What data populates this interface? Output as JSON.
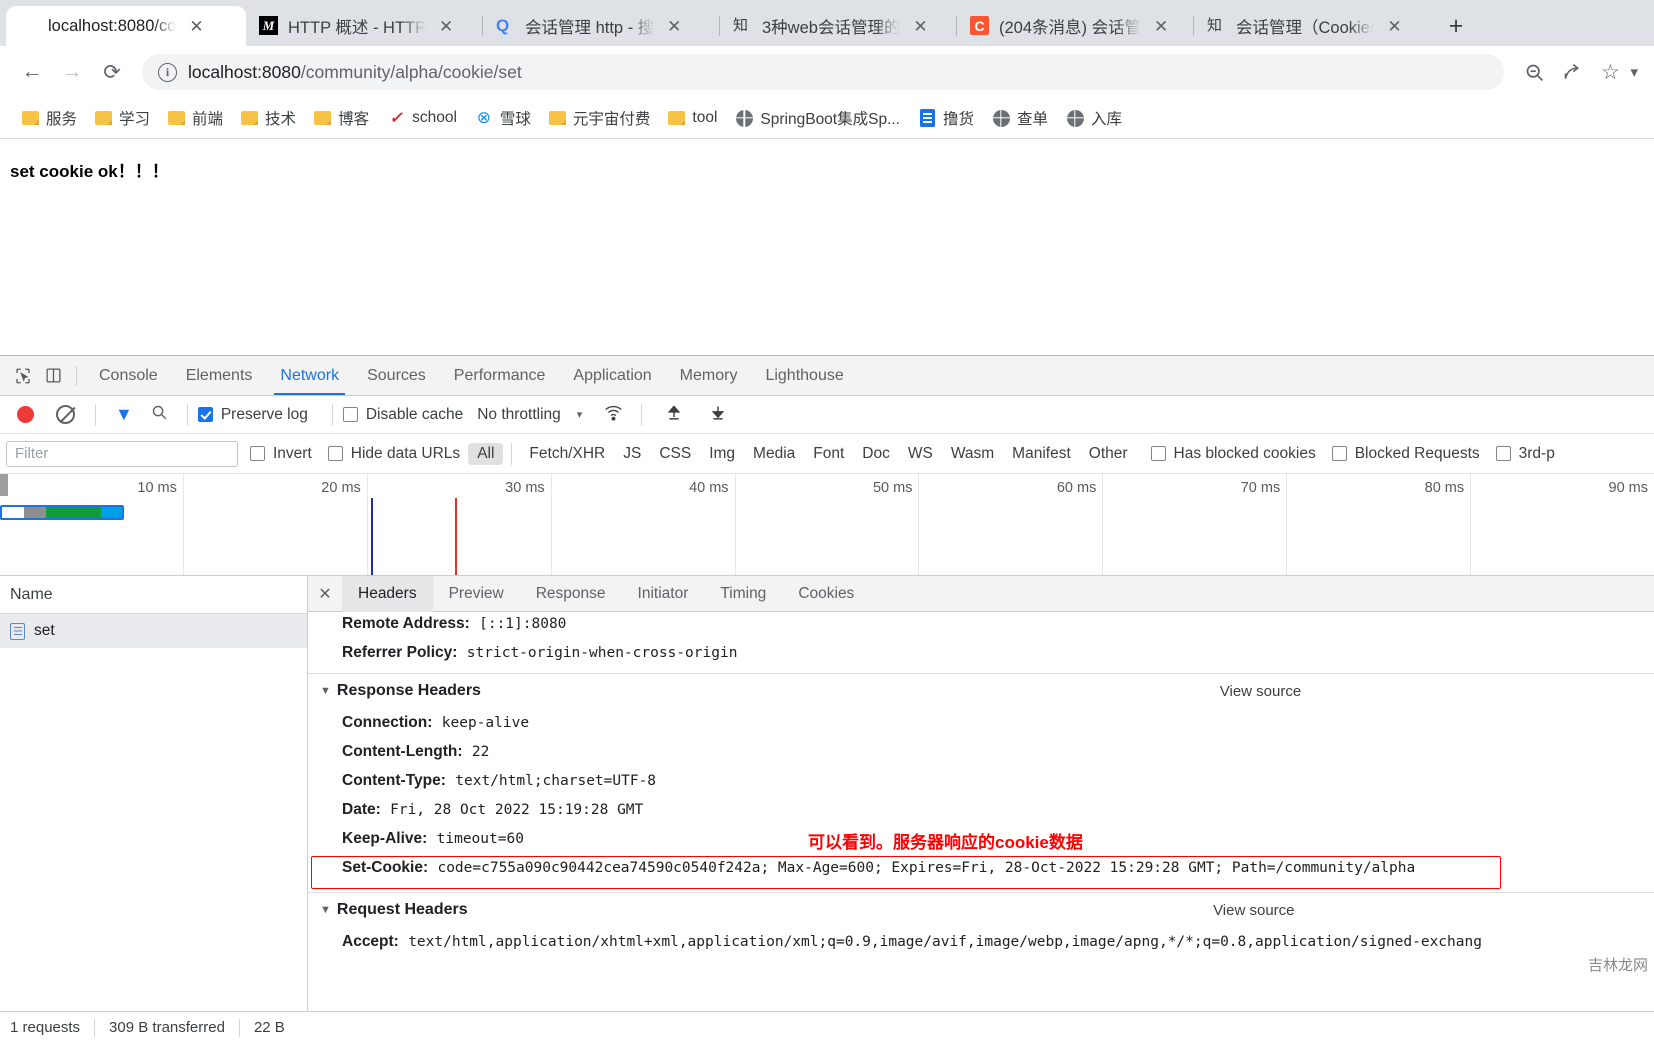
{
  "browser": {
    "tabs": [
      {
        "title": "localhost:8080/co",
        "favicon": "globe-icon",
        "active": true
      },
      {
        "title": "HTTP 概述 - HTTP",
        "favicon": "mdn-icon",
        "active": false
      },
      {
        "title": "会话管理 http - 搜",
        "favicon": "search-icon",
        "active": false
      },
      {
        "title": "3种web会话管理的",
        "favicon": "zhihu-icon",
        "active": false
      },
      {
        "title": "(204条消息) 会话管",
        "favicon": "csdn-icon",
        "active": false
      },
      {
        "title": "会话管理（Cookie/",
        "favicon": "zhihu-icon",
        "active": false
      }
    ],
    "new_tab_label": "+",
    "close_label": "✕",
    "nav": {
      "back": "←",
      "forward": "→",
      "reload": "⟳",
      "info_icon": "i",
      "url_host": "localhost:8080",
      "url_path": "/community/alpha/cookie/set",
      "zoom_icon": "🔍",
      "share_icon": "share-icon",
      "bookmark_icon": "☆",
      "menu_icon": "▾"
    },
    "bookmarks": [
      {
        "label": "服务",
        "icon": "folder-icon"
      },
      {
        "label": "学习",
        "icon": "folder-icon"
      },
      {
        "label": "前端",
        "icon": "folder-icon"
      },
      {
        "label": "技术",
        "icon": "folder-icon"
      },
      {
        "label": "博客",
        "icon": "folder-icon"
      },
      {
        "label": "school",
        "icon": "school-icon"
      },
      {
        "label": "雪球",
        "icon": "xueqiu-icon"
      },
      {
        "label": "元宇宙付费",
        "icon": "folder-icon"
      },
      {
        "label": "tool",
        "icon": "folder-icon"
      },
      {
        "label": "SpringBoot集成Sp...",
        "icon": "globe-icon"
      },
      {
        "label": "撸货",
        "icon": "doc-icon"
      },
      {
        "label": "查单",
        "icon": "globe-icon"
      },
      {
        "label": "入库",
        "icon": "globe-icon"
      }
    ]
  },
  "page": {
    "body_text": "set cookie ok！！！"
  },
  "devtools": {
    "panel_tabs": [
      {
        "label": "Console",
        "active": false
      },
      {
        "label": "Elements",
        "active": false
      },
      {
        "label": "Network",
        "active": true
      },
      {
        "label": "Sources",
        "active": false
      },
      {
        "label": "Performance",
        "active": false
      },
      {
        "label": "Application",
        "active": false
      },
      {
        "label": "Memory",
        "active": false
      },
      {
        "label": "Lighthouse",
        "active": false
      }
    ],
    "toolbar": {
      "record_label": "record-button",
      "clear_label": "clear-button",
      "filter_label": "filter-toggle",
      "search_label": "search-button",
      "preserve_log": "Preserve log",
      "preserve_log_checked": true,
      "disable_cache": "Disable cache",
      "disable_cache_checked": false,
      "throttling": "No throttling",
      "caret": "▾",
      "wifi_icon": "network-conditions-icon",
      "import_icon": "↑",
      "export_icon": "↓"
    },
    "filterbar": {
      "filter_placeholder": "Filter",
      "invert": "Invert",
      "invert_checked": false,
      "hide_data_urls": "Hide data URLs",
      "hide_data_urls_checked": false,
      "types": [
        "All",
        "Fetch/XHR",
        "JS",
        "CSS",
        "Img",
        "Media",
        "Font",
        "Doc",
        "WS",
        "Wasm",
        "Manifest",
        "Other"
      ],
      "active_type": "All",
      "has_blocked_cookies": "Has blocked cookies",
      "has_blocked_cookies_checked": false,
      "blocked_requests": "Blocked Requests",
      "blocked_requests_checked": false,
      "third_party": "3rd-p",
      "third_party_checked": false
    },
    "timeline": {
      "ticks": [
        "10 ms",
        "20 ms",
        "30 ms",
        "40 ms",
        "50 ms",
        "60 ms",
        "70 ms",
        "80 ms",
        "90 ms"
      ],
      "bar_colors": {
        "queue": "#ffffff",
        "stalled": "#8e8e8e",
        "wait": "#0f9d3a",
        "download": "#00a0e9",
        "border": "#1a73e8"
      },
      "event_lines": [
        {
          "color": "#1f2ea8",
          "label": "DOMContentLoaded"
        },
        {
          "color": "#e1312a",
          "label": "Load"
        }
      ]
    },
    "request_list": {
      "column_header": "Name",
      "rows": [
        {
          "name": "set",
          "icon": "document-icon",
          "selected": true
        }
      ]
    },
    "detail": {
      "tabs": [
        {
          "label": "Headers",
          "active": true
        },
        {
          "label": "Preview",
          "active": false
        },
        {
          "label": "Response",
          "active": false
        },
        {
          "label": "Initiator",
          "active": false
        },
        {
          "label": "Timing",
          "active": false
        },
        {
          "label": "Cookies",
          "active": false
        }
      ],
      "close_label": "✕",
      "general": [
        {
          "key": "Remote Address:",
          "value": "[::1]:8080"
        },
        {
          "key": "Referrer Policy:",
          "value": "strict-origin-when-cross-origin"
        }
      ],
      "response_headers": {
        "title": "Response Headers",
        "view_source": "View source",
        "triangle": "▼",
        "items": [
          {
            "key": "Connection:",
            "value": "keep-alive"
          },
          {
            "key": "Content-Length:",
            "value": "22"
          },
          {
            "key": "Content-Type:",
            "value": "text/html;charset=UTF-8"
          },
          {
            "key": "Date:",
            "value": "Fri, 28 Oct 2022 15:19:28 GMT"
          },
          {
            "key": "Keep-Alive:",
            "value": "timeout=60"
          },
          {
            "key": "Set-Cookie:",
            "value": "code=c755a090c90442cea74590c0540f242a; Max-Age=600; Expires=Fri, 28-Oct-2022 15:29:28 GMT; Path=/community/alpha",
            "highlighted": true
          }
        ]
      },
      "request_headers": {
        "title": "Request Headers",
        "view_source": "View source",
        "triangle": "▼",
        "items": [
          {
            "key": "Accept:",
            "value": "text/html,application/xhtml+xml,application/xml;q=0.9,image/avif,image/webp,image/apng,*/*;q=0.8,application/signed-exchang"
          }
        ]
      },
      "annotation": "可以看到。服务器响应的cookie数据"
    },
    "status": {
      "requests": "1 requests",
      "transferred": "309 B transferred",
      "resources": "22 B"
    },
    "watermark": "吉林龙网"
  },
  "colors": {
    "accent": "#1a73e8",
    "tabstrip_bg": "#dee1e6",
    "record_red": "#ec3b36",
    "annotation_red": "#ff0000"
  }
}
